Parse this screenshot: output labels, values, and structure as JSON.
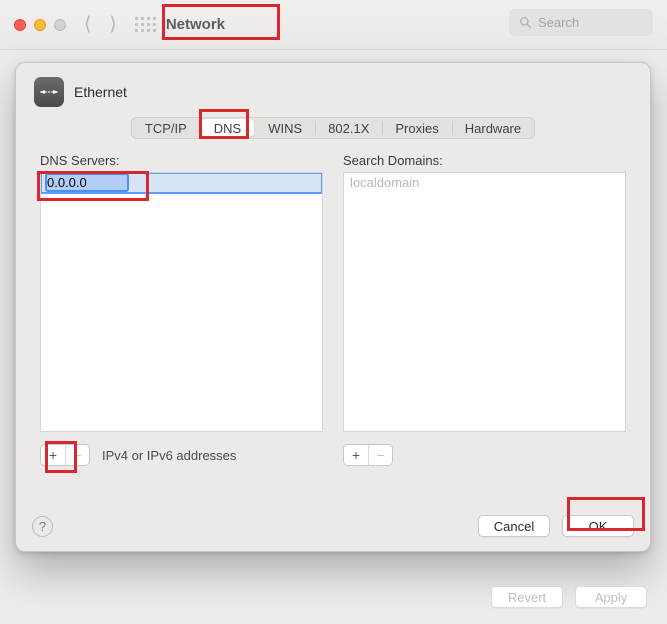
{
  "window": {
    "title": "Network",
    "search_placeholder": "Search"
  },
  "interface": {
    "name": "Ethernet"
  },
  "tabs": {
    "tcpip": "TCP/IP",
    "dns": "DNS",
    "wins": "WINS",
    "dot1x": "802.1X",
    "proxies": "Proxies",
    "hardware": "Hardware"
  },
  "dns": {
    "section_label": "DNS Servers:",
    "servers": [
      "0.0.0.0"
    ],
    "hint": "IPv4 or IPv6 addresses"
  },
  "domains": {
    "section_label": "Search Domains:",
    "placeholder": "localdomain"
  },
  "glyphs": {
    "plus": "+",
    "minus": "−",
    "help": "?"
  },
  "buttons": {
    "cancel": "Cancel",
    "ok": "OK",
    "revert": "Revert",
    "apply": "Apply"
  }
}
